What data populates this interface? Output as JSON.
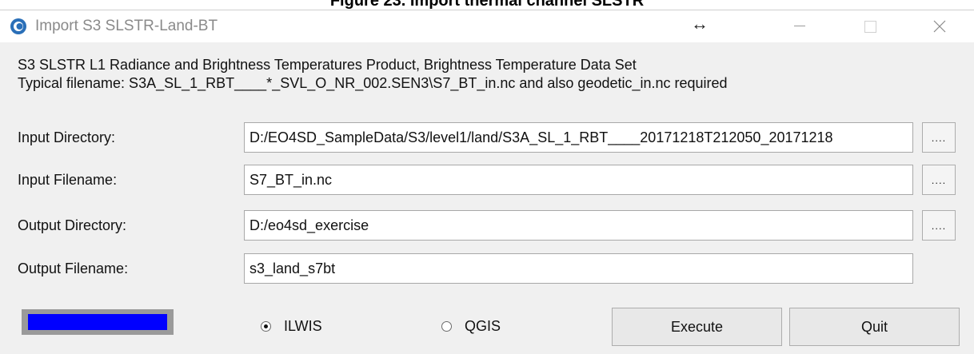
{
  "caption": "Figure 23. Import thermal channel SLSTR",
  "window": {
    "title": "Import S3 SLSTR-Land-BT",
    "resize_glyph": "↔",
    "icons": [
      "app-icon",
      "minimize-icon",
      "maximize-icon",
      "close-icon"
    ]
  },
  "description": {
    "line1": "S3 SLSTR L1 Radiance and Brightness Temperatures Product, Brightness Temperature Data Set",
    "line2": "Typical filename: S3A_SL_1_RBT____*_SVL_O_NR_002.SEN3\\S7_BT_in.nc and also geodetic_in.nc required"
  },
  "form": {
    "input_directory": {
      "label": "Input Directory:",
      "value": "D:/EO4SD_SampleData/S3/level1/land/S3A_SL_1_RBT____20171218T212050_20171218"
    },
    "input_filename": {
      "label": "Input Filename:",
      "value": "S7_BT_in.nc"
    },
    "output_directory": {
      "label": "Output Directory:",
      "value": "D:/eo4sd_exercise"
    },
    "output_filename": {
      "label": "Output Filename:",
      "value": "s3_land_s7bt"
    },
    "browse_label": "...."
  },
  "progress": {
    "fraction": 1.0,
    "color": "#0000ff"
  },
  "options": {
    "ilwis": {
      "label": "ILWIS",
      "selected": true
    },
    "qgis": {
      "label": "QGIS",
      "selected": false
    }
  },
  "buttons": {
    "execute": "Execute",
    "quit": "Quit"
  }
}
